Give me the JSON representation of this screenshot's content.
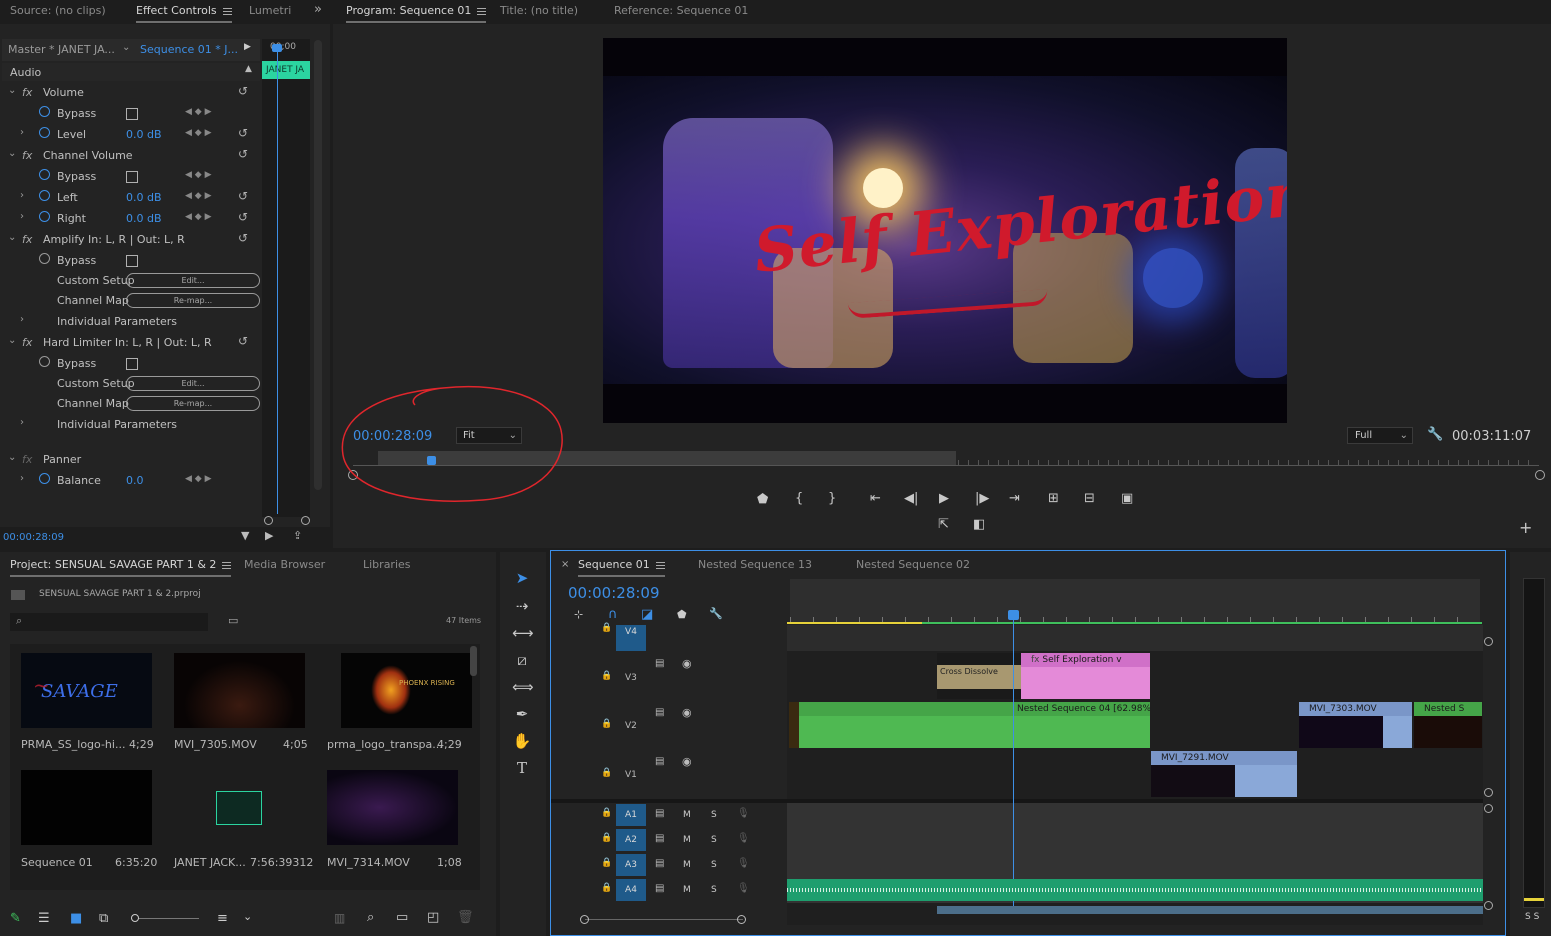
{
  "source_panel": {
    "tabs": [
      "Source: (no clips)",
      "Effect Controls",
      "Lumetri"
    ],
    "master_label": "Master * JANET JA...",
    "sequence_label": "Sequence 01 * J...",
    "mini_timecode": "00;00",
    "clip_label": "JANET JA",
    "section": "Audio",
    "effects": [
      {
        "name": "Volume",
        "params": [
          {
            "label": "Bypass"
          },
          {
            "label": "Level",
            "value": "0.0 dB"
          }
        ]
      },
      {
        "name": "Channel Volume",
        "params": [
          {
            "label": "Bypass"
          },
          {
            "label": "Left",
            "value": "0.0 dB"
          },
          {
            "label": "Right",
            "value": "0.0 dB"
          }
        ]
      },
      {
        "name": "Amplify In: L, R | Out: L, R",
        "params": [
          {
            "label": "Bypass"
          },
          {
            "label": "Custom Setup",
            "button": "Edit..."
          },
          {
            "label": "Channel Map",
            "button": "Re-map..."
          },
          {
            "label": "Individual Parameters"
          }
        ]
      },
      {
        "name": "Hard Limiter In: L, R | Out: L, R",
        "params": [
          {
            "label": "Bypass"
          },
          {
            "label": "Custom Setup",
            "button": "Edit..."
          },
          {
            "label": "Channel Map",
            "button": "Re-map..."
          },
          {
            "label": "Individual Parameters"
          }
        ]
      },
      {
        "name": "Panner",
        "params": [
          {
            "label": "Balance",
            "value": "0.0"
          }
        ]
      }
    ],
    "footer_timecode": "00:00:28:09"
  },
  "program_panel": {
    "tabs": [
      "Program: Sequence 01",
      "Title: (no title)",
      "Reference: Sequence 01"
    ],
    "overlay_title": "Self Exploration",
    "timecode": "00:00:28:09",
    "fit_label": "Fit",
    "quality_label": "Full",
    "duration": "00:03:11:07"
  },
  "project_panel": {
    "tabs": [
      "Project: SENSUAL SAVAGE PART 1 & 2",
      "Media Browser",
      "Libraries"
    ],
    "project_file": "SENSUAL SAVAGE PART 1 & 2.prproj",
    "items_count": "47 Items",
    "search_placeholder": "",
    "items": [
      {
        "name": "PRMA_SS_logo-hi...",
        "duration": "4;29"
      },
      {
        "name": "MVI_7305.MOV",
        "duration": "4;05"
      },
      {
        "name": "prma_logo_transpa...",
        "duration": "4;29"
      },
      {
        "name": "Sequence 01",
        "duration": "6:35:20"
      },
      {
        "name": "JANET JACK...",
        "duration": "7:56:39312"
      },
      {
        "name": "MVI_7314.MOV",
        "duration": "1;08"
      }
    ],
    "logo_text": "SAVAGE",
    "phoenix_text": "PHOENX RISING"
  },
  "timeline_panel": {
    "tabs": [
      "Sequence 01",
      "Nested Sequence 13",
      "Nested Sequence 02"
    ],
    "timecode": "00:00:28:09",
    "video_tracks": [
      "V4",
      "V3",
      "V2",
      "V1"
    ],
    "audio_tracks": [
      "A1",
      "A2",
      "A3",
      "A4"
    ],
    "mute_label": "M",
    "solo_label": "S",
    "clips": {
      "cross_dissolve": "Cross Dissolve",
      "self_exploration": "Self Exploration",
      "nested_04": "Nested Sequence 04 [62.98%]",
      "mvi_7303": "MVI_7303.MOV",
      "nested_s": "Nested S",
      "mvi_7291": "MVI_7291.MOV"
    },
    "meter_label": "S S"
  },
  "colors": {
    "accent_blue": "#2d8ceb",
    "clip_pink": "#e48ad8",
    "clip_green": "#4fb952",
    "clip_blue": "#8aa8d8",
    "audio_green": "#1e9e6e",
    "annotation_red": "#e0262c"
  }
}
